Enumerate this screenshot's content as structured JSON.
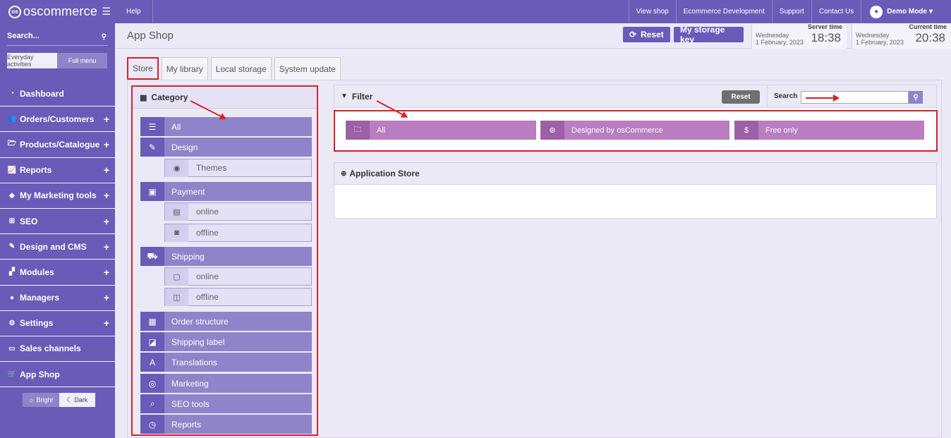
{
  "sidebar": {
    "logo_text": "oscommerce",
    "search_label": "Search...",
    "toggle_everyday": "Everyday activities",
    "toggle_full": "Full menu",
    "items": [
      {
        "label": "Dashboard",
        "icon": "dashboard-icon",
        "glyph": "◔",
        "plus": false
      },
      {
        "label": "Orders/Customers",
        "icon": "users-icon",
        "glyph": "👥",
        "plus": true
      },
      {
        "label": "Products/Catalogue",
        "icon": "folder-icon",
        "glyph": "🗁",
        "plus": true
      },
      {
        "label": "Reports",
        "icon": "chart-icon",
        "glyph": "📈",
        "plus": true
      },
      {
        "label": "My Marketing tools",
        "icon": "tag-icon",
        "glyph": "◈",
        "plus": true
      },
      {
        "label": "SEO",
        "icon": "sitemap-icon",
        "glyph": "⊞",
        "plus": true
      },
      {
        "label": "Design and CMS",
        "icon": "brush-icon",
        "glyph": "✎",
        "plus": true
      },
      {
        "label": "Modules",
        "icon": "puzzle-icon",
        "glyph": "▞",
        "plus": true
      },
      {
        "label": "Managers",
        "icon": "user-icon",
        "glyph": "●",
        "plus": true
      },
      {
        "label": "Settings",
        "icon": "gears-icon",
        "glyph": "⚙",
        "plus": true
      },
      {
        "label": "Sales channels",
        "icon": "monitor-icon",
        "glyph": "▭",
        "plus": false
      },
      {
        "label": "App Shop",
        "icon": "cart-icon",
        "glyph": "🛒",
        "plus": false
      }
    ],
    "theme_bright": "Bright",
    "theme_dark": "Dark"
  },
  "topbar": {
    "help": "Help",
    "links": [
      "View shop",
      "Ecommerce Development",
      "Support",
      "Contact Us"
    ],
    "demo_mode": "Demo Mode"
  },
  "header": {
    "title": "App Shop",
    "reset_label": "Reset",
    "storage_key_label": "My storage key",
    "server_time": {
      "label": "Server time",
      "day": "Wednesday",
      "date": "1 February, 2023",
      "time": "18:38"
    },
    "current_time": {
      "label": "Current time",
      "day": "Wednesday",
      "date": "1 February, 2023",
      "time": "20:38"
    }
  },
  "tabs": [
    "Store",
    "My library",
    "Local storage",
    "System update"
  ],
  "category": {
    "title": "Category",
    "items": [
      {
        "label": "All",
        "type": "main",
        "icon": "list-icon",
        "glyph": "☰"
      },
      {
        "label": "Design",
        "type": "main",
        "icon": "edit-icon",
        "glyph": "✎"
      },
      {
        "label": "Themes",
        "type": "sub",
        "icon": "eye-icon",
        "glyph": "◉"
      },
      {
        "label": "Payment",
        "type": "main",
        "icon": "wallet-icon",
        "glyph": "▣"
      },
      {
        "label": "online",
        "type": "sub",
        "icon": "card-icon",
        "glyph": "▤"
      },
      {
        "label": "offline",
        "type": "sub",
        "icon": "cash-icon",
        "glyph": "◙"
      },
      {
        "label": "Shipping",
        "type": "main",
        "icon": "truck-icon",
        "glyph": "⛟"
      },
      {
        "label": "online",
        "type": "sub",
        "icon": "save-icon",
        "glyph": "▢"
      },
      {
        "label": "offline",
        "type": "sub",
        "icon": "package-icon",
        "glyph": "◫"
      },
      {
        "label": "Order structure",
        "type": "main",
        "icon": "order-structure-icon",
        "glyph": "▦"
      },
      {
        "label": "Shipping label",
        "type": "main",
        "icon": "label-icon",
        "glyph": "◪"
      },
      {
        "label": "Translations",
        "type": "main",
        "icon": "translate-icon",
        "glyph": "A"
      },
      {
        "label": "Marketing",
        "type": "main",
        "icon": "target-icon",
        "glyph": "◎"
      },
      {
        "label": "SEO tools",
        "type": "main",
        "icon": "seo-search-icon",
        "glyph": "⌕"
      },
      {
        "label": "Reports",
        "type": "main",
        "icon": "report-icon",
        "glyph": "◷"
      }
    ]
  },
  "filter": {
    "title": "Filter",
    "reset_label": "Reset",
    "search_label": "Search",
    "search_value": "",
    "options": [
      {
        "label": "All",
        "icon": "folder-open-icon",
        "glyph": "🗀"
      },
      {
        "label": "Designed by osCommerce",
        "icon": "circles-icon",
        "glyph": "⊛"
      },
      {
        "label": "Free only",
        "icon": "dollar-icon",
        "glyph": "$"
      }
    ]
  },
  "app_store": {
    "title": "Application Store"
  }
}
